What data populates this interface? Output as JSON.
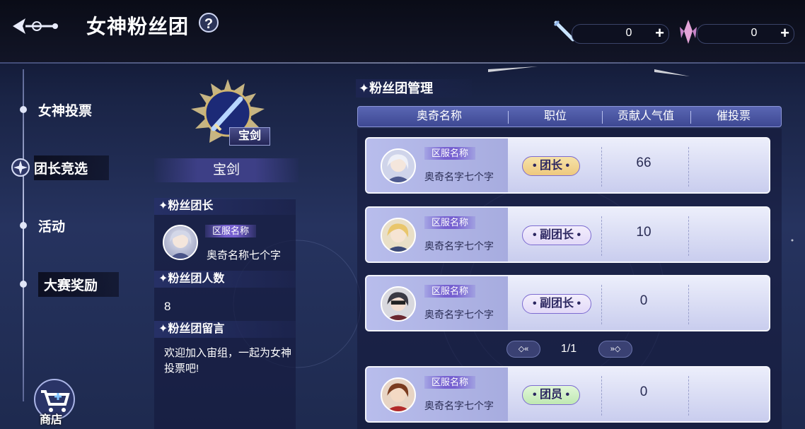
{
  "header": {
    "title": "女神粉丝团",
    "help_label": "?",
    "resources": [
      {
        "icon": "sword-ticket-icon",
        "value": "0",
        "plus": "+"
      },
      {
        "icon": "crystal-icon",
        "value": "0",
        "plus": "+"
      }
    ]
  },
  "nav": {
    "items": [
      {
        "label": "女神投票"
      },
      {
        "label": "团长竞选"
      },
      {
        "label": "活动"
      },
      {
        "label": "大赛奖励"
      }
    ],
    "shop_label": "商店"
  },
  "group": {
    "emblem_label": "宝剑",
    "name": "宝剑",
    "leader_title": "✦粉丝团长",
    "leader_server": "区服名称",
    "leader_name": "奥奇名称七个字",
    "count_title": "✦粉丝团人数",
    "count_value": "8",
    "message_title": "✦粉丝团留言",
    "message": "欢迎加入宙组，一起为女神投票吧!"
  },
  "management": {
    "title": "✦粉丝团管理",
    "columns": [
      "奥奇名称",
      "职位",
      "贡献人气值",
      "催投票"
    ],
    "rows": [
      {
        "server": "区服名称",
        "name": "奥奇名字七个字",
        "role": "• 团长 •",
        "role_type": "leader",
        "contribution": "66"
      },
      {
        "server": "区服名称",
        "name": "奥奇名字七个字",
        "role": "• 副团长 •",
        "role_type": "vice",
        "contribution": "10"
      },
      {
        "server": "区服名称",
        "name": "奥奇名字七个字",
        "role": "• 副团长 •",
        "role_type": "vice",
        "contribution": "0"
      },
      {
        "server": "区服名称",
        "name": "奥奇名字七个字",
        "role": "• 团员 •",
        "role_type": "member",
        "contribution": "0"
      }
    ],
    "pager": {
      "prev": "◇«",
      "next": "»◇",
      "text": "1/1"
    }
  }
}
